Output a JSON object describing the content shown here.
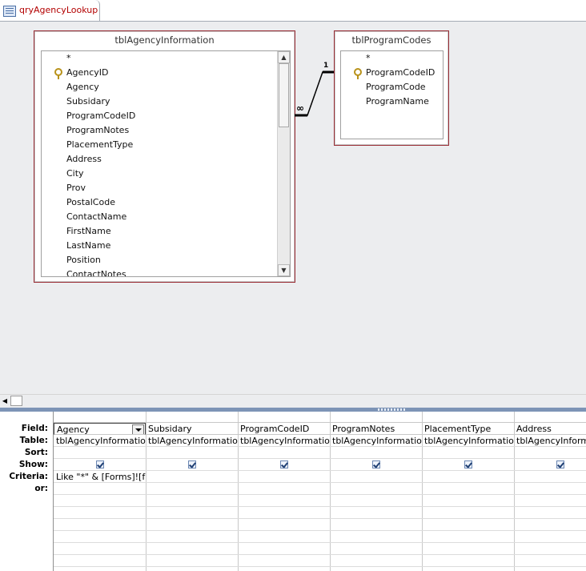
{
  "tab": {
    "title": "qryAgencyLookup",
    "icon": "query-icon"
  },
  "tables": [
    {
      "name": "tblAgencyInformation",
      "fields": [
        "*",
        "AgencyID",
        "Agency",
        "Subsidary",
        "ProgramCodeID",
        "ProgramNotes",
        "PlacementType",
        "Address",
        "City",
        "Prov",
        "PostalCode",
        "ContactName",
        "FirstName",
        "LastName",
        "Position",
        "ContactNotes"
      ],
      "primary_key": "AgencyID"
    },
    {
      "name": "tblProgramCodes",
      "fields": [
        "*",
        "ProgramCodeID",
        "ProgramCode",
        "ProgramName"
      ],
      "primary_key": "ProgramCodeID"
    }
  ],
  "relationship": {
    "one_label": "1",
    "many_label": "∞"
  },
  "grid": {
    "row_labels": [
      "Field:",
      "Table:",
      "Sort:",
      "Show:",
      "Criteria:",
      "or:"
    ],
    "columns": [
      {
        "field": "Agency",
        "table": "tblAgencyInformation",
        "sort": "",
        "show": true,
        "criteria": "Like \"*\" & [Forms]![frm",
        "or": ""
      },
      {
        "field": "Subsidary",
        "table": "tblAgencyInformation",
        "sort": "",
        "show": true,
        "criteria": "",
        "or": ""
      },
      {
        "field": "ProgramCodeID",
        "table": "tblAgencyInformation",
        "sort": "",
        "show": true,
        "criteria": "",
        "or": ""
      },
      {
        "field": "ProgramNotes",
        "table": "tblAgencyInformation",
        "sort": "",
        "show": true,
        "criteria": "",
        "or": ""
      },
      {
        "field": "PlacementType",
        "table": "tblAgencyInformation",
        "sort": "",
        "show": true,
        "criteria": "",
        "or": ""
      },
      {
        "field": "Address",
        "table": "tblAgencyInformation",
        "sort": "",
        "show": true,
        "criteria": "",
        "or": ""
      }
    ]
  },
  "colors": {
    "table_border": "#9b2d35",
    "tab_text": "#b30000",
    "splitter": "#7d94b6"
  }
}
